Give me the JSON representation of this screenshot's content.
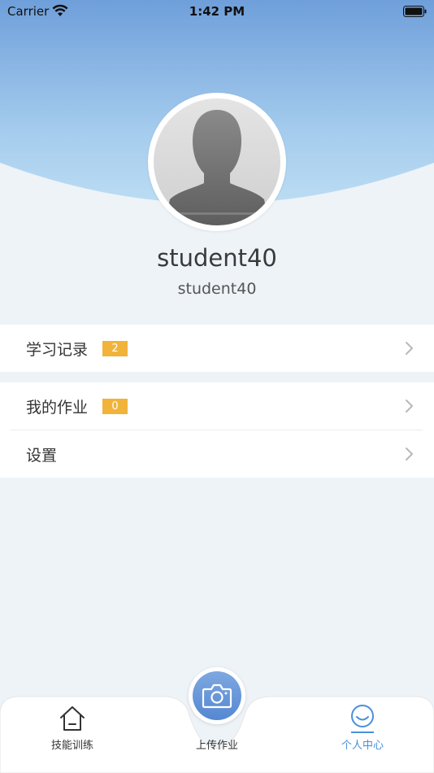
{
  "status_bar": {
    "carrier": "Carrier",
    "time": "1:42 PM"
  },
  "profile": {
    "name": "student40",
    "id": "student40"
  },
  "menu": {
    "study_records": {
      "label": "学习记录",
      "badge": "2"
    },
    "my_homework": {
      "label": "我的作业",
      "badge": "0"
    },
    "settings": {
      "label": "设置"
    }
  },
  "tabbar": {
    "skill_training": "技能训练",
    "upload_homework": "上传作业",
    "personal_center": "个人中心"
  },
  "colors": {
    "accent": "#4a90d9",
    "badge": "#f2b33a",
    "background": "#eef3f8"
  }
}
